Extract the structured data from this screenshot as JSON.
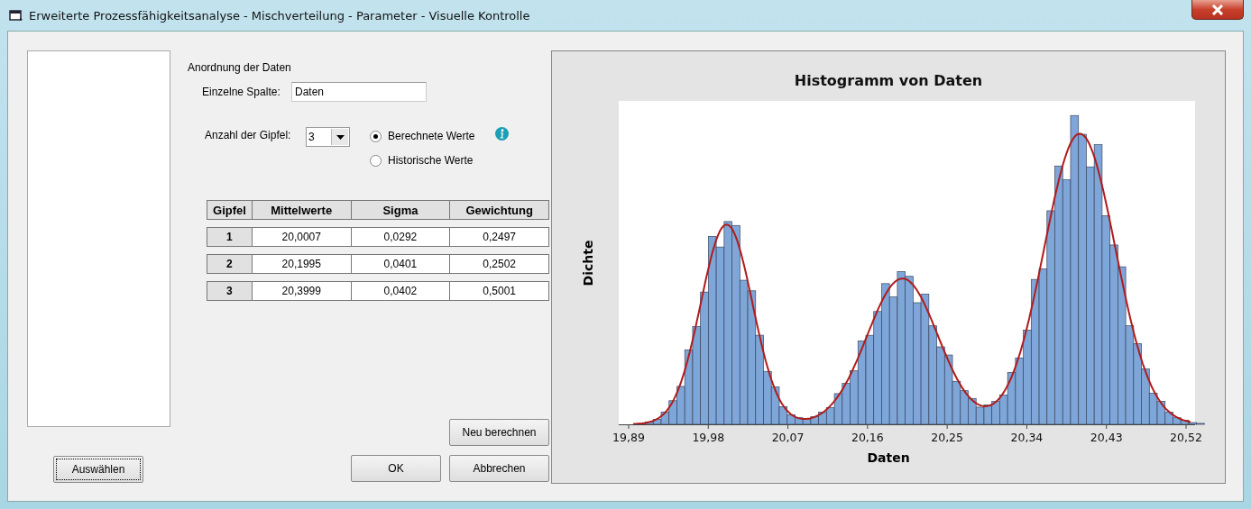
{
  "window": {
    "title": "Erweiterte Prozessfähigkeitsanalyse - Mischverteilung - Parameter - Visuelle Kontrolle"
  },
  "select_button": "Auswählen",
  "data_arrangement": {
    "heading": "Anordnung der Daten",
    "single_column": {
      "label": "Einzelne Spalte:",
      "value": "Daten"
    },
    "peak_count": {
      "label": "Anzahl der Gipfel:",
      "value": "3"
    },
    "options": [
      {
        "label": "Berechnete Werte",
        "selected": true
      },
      {
        "label": "Historische Werte",
        "selected": false
      }
    ]
  },
  "table": {
    "columns": [
      "Gipfel",
      "Mittelwerte",
      "Sigma",
      "Gewichtung"
    ],
    "rows": [
      [
        "1",
        "20,0007",
        "0,0292",
        "0,2497"
      ],
      [
        "2",
        "20,1995",
        "0,0401",
        "0,2502"
      ],
      [
        "3",
        "20,3999",
        "0,0402",
        "0,5001"
      ]
    ]
  },
  "buttons": {
    "recalculate": "Neu berechnen",
    "ok": "OK",
    "cancel": "Abbrechen"
  },
  "histogram": {
    "title": "Histogramm von Daten",
    "xlabel": "Daten",
    "ylabel": "Dichte",
    "xticks": [
      "19,89",
      "19,98",
      "20,07",
      "20,16",
      "20,25",
      "20,34",
      "20,43",
      "20,52"
    ]
  }
}
